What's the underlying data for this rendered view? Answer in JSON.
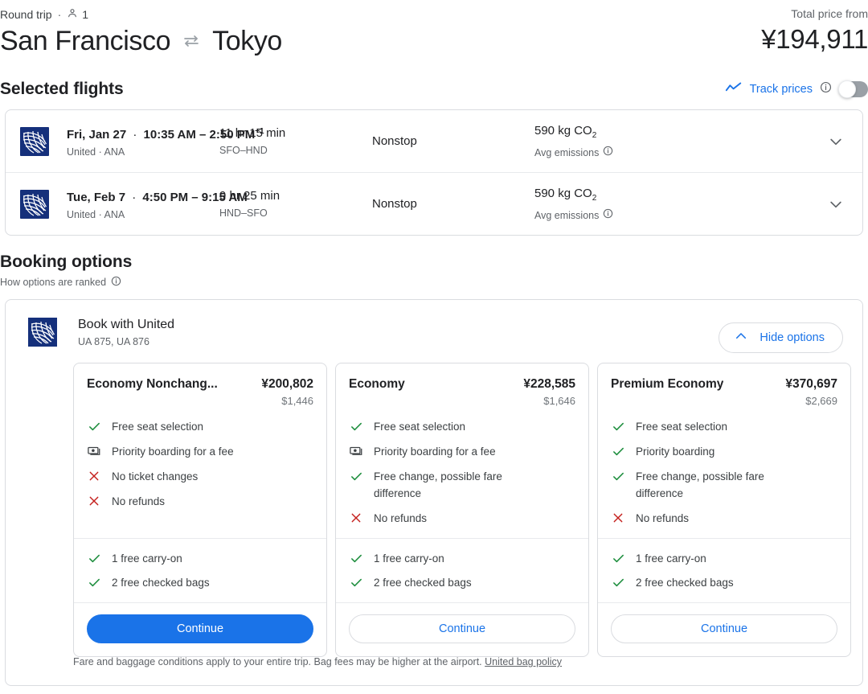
{
  "header": {
    "trip_type": "Round trip",
    "separator": "·",
    "passengers": "1",
    "passenger_icon": "person-icon",
    "origin": "San Francisco",
    "swap_icon": "swap-arrows-icon",
    "destination": "Tokyo",
    "total_label": "Total price from",
    "total_price": "¥194,911"
  },
  "selected_flights": {
    "title": "Selected flights",
    "track_prices_label": "Track prices",
    "track_prices_icon": "trending-up-icon",
    "track_info_icon": "info-icon",
    "track_toggle_state": "off",
    "rows": [
      {
        "airline_logo": "united-airlines-logo",
        "date": "Fri, Jan 27",
        "date_separator": "·",
        "times": "10:35 AM – 2:50 PM",
        "day_offset": "+1",
        "airlines": "United · ANA",
        "duration": "11 hr 15 min",
        "airports": "SFO–HND",
        "stops": "Nonstop",
        "emissions": "590 kg CO",
        "emissions_sub": "2",
        "emissions_label": "Avg emissions",
        "emissions_info_icon": "info-icon",
        "expand_icon": "chevron-down-icon"
      },
      {
        "airline_logo": "united-airlines-logo",
        "date": "Tue, Feb 7",
        "date_separator": "·",
        "times": "4:50 PM – 9:15 AM",
        "day_offset": "",
        "airlines": "United · ANA",
        "duration": "9 hr 25 min",
        "airports": "HND–SFO",
        "stops": "Nonstop",
        "emissions": "590 kg CO",
        "emissions_sub": "2",
        "emissions_label": "Avg emissions",
        "emissions_info_icon": "info-icon",
        "expand_icon": "chevron-down-icon"
      }
    ]
  },
  "booking_options": {
    "title": "Booking options",
    "ranked_text": "How options are ranked",
    "ranked_info_icon": "info-icon",
    "provider": {
      "logo": "united-airlines-logo",
      "name": "Book with United",
      "flight_numbers": "UA 875, UA 876",
      "hide_button_label": "Hide options",
      "hide_button_icon": "chevron-up-icon"
    },
    "fares": [
      {
        "name": "Economy Nonchang...",
        "price": "¥200,802",
        "price_alt": "$1,446",
        "features": [
          {
            "icon": "check-icon",
            "text": "Free seat selection"
          },
          {
            "icon": "money-icon",
            "text": "Priority boarding for a fee"
          },
          {
            "icon": "cross-icon",
            "text": "No ticket changes"
          },
          {
            "icon": "cross-icon",
            "text": "No refunds"
          }
        ],
        "bags": [
          {
            "icon": "check-icon",
            "text": "1 free carry-on"
          },
          {
            "icon": "check-icon",
            "text": "2 free checked bags"
          }
        ],
        "cta_label": "Continue",
        "cta_style": "filled"
      },
      {
        "name": "Economy",
        "price": "¥228,585",
        "price_alt": "$1,646",
        "features": [
          {
            "icon": "check-icon",
            "text": "Free seat selection"
          },
          {
            "icon": "money-icon",
            "text": "Priority boarding for a fee"
          },
          {
            "icon": "check-icon",
            "text": "Free change, possible fare difference"
          },
          {
            "icon": "cross-icon",
            "text": "No refunds"
          }
        ],
        "bags": [
          {
            "icon": "check-icon",
            "text": "1 free carry-on"
          },
          {
            "icon": "check-icon",
            "text": "2 free checked bags"
          }
        ],
        "cta_label": "Continue",
        "cta_style": "outline"
      },
      {
        "name": "Premium Economy",
        "price": "¥370,697",
        "price_alt": "$2,669",
        "features": [
          {
            "icon": "check-icon",
            "text": "Free seat selection"
          },
          {
            "icon": "check-icon",
            "text": "Priority boarding"
          },
          {
            "icon": "check-icon",
            "text": "Free change, possible fare difference"
          },
          {
            "icon": "cross-icon",
            "text": "No refunds"
          }
        ],
        "bags": [
          {
            "icon": "check-icon",
            "text": "1 free carry-on"
          },
          {
            "icon": "check-icon",
            "text": "2 free checked bags"
          }
        ],
        "cta_label": "Continue",
        "cta_style": "outline"
      }
    ],
    "fine_print": "Fare and baggage conditions apply to your entire trip. Bag fees may be higher at the airport.",
    "fine_print_link": "United bag policy"
  },
  "colors": {
    "accent_blue": "#1a73e8",
    "check_green": "#1e8e3e",
    "cross_red": "#c5221f",
    "united_navy": "#15307b",
    "text_primary": "#202124",
    "text_secondary": "#5f6368",
    "border": "#dadce0"
  }
}
